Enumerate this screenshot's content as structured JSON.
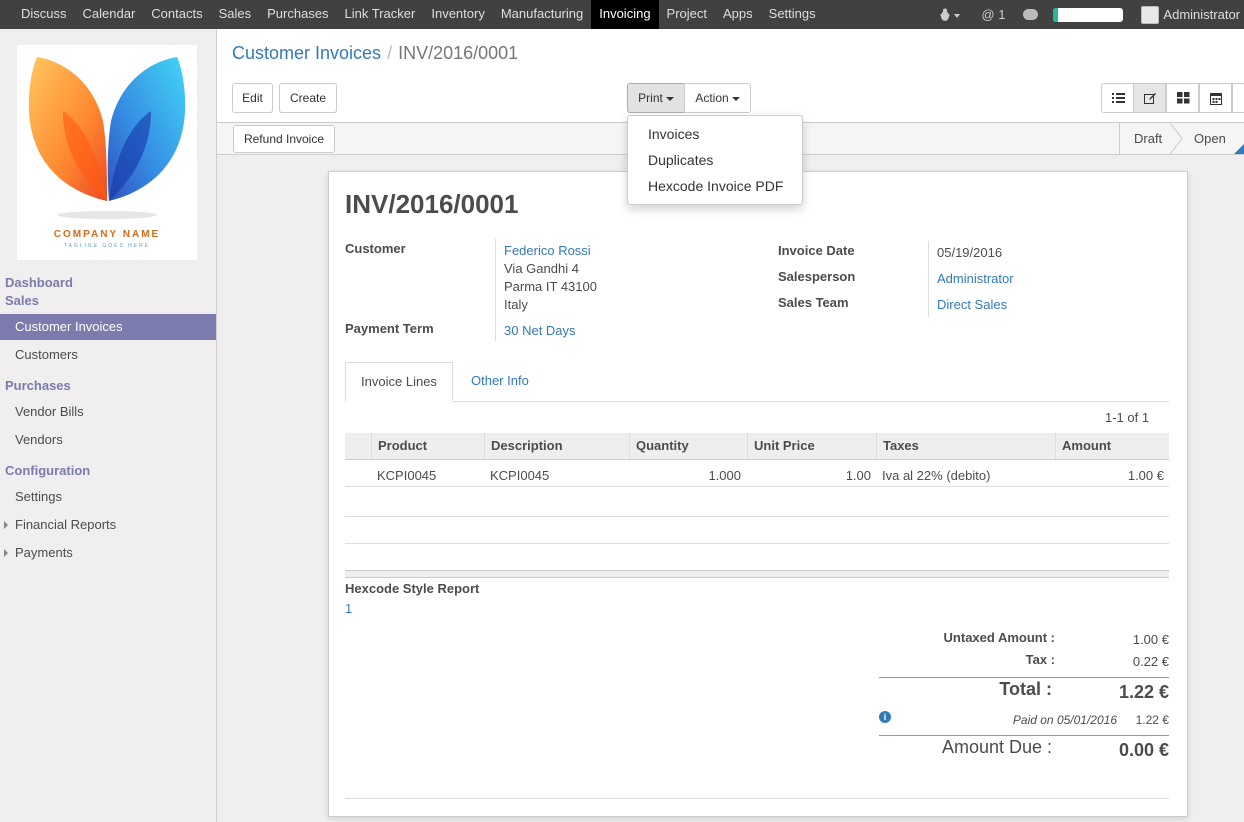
{
  "topbar": {
    "menu": [
      "Discuss",
      "Calendar",
      "Contacts",
      "Sales",
      "Purchases",
      "Link Tracker",
      "Inventory",
      "Manufacturing",
      "Invoicing",
      "Project",
      "Apps",
      "Settings"
    ],
    "active": "Invoicing",
    "at_count": "1",
    "user": "Administrator",
    "progress_fraction": 0.06
  },
  "sidebar": {
    "logo_name": "COMPANY NAME",
    "logo_tagline": "TAGLINE GOES HERE",
    "dashboard": "Dashboard",
    "sales": "Sales",
    "customer_invoices": "Customer Invoices",
    "customers": "Customers",
    "purchases": "Purchases",
    "vendor_bills": "Vendor Bills",
    "vendors": "Vendors",
    "configuration": "Configuration",
    "settings": "Settings",
    "financial_reports": "Financial Reports",
    "payments": "Payments"
  },
  "breadcrumb": {
    "parent": "Customer Invoices",
    "sep": "/",
    "current": "INV/2016/0001"
  },
  "buttons": {
    "edit": "Edit",
    "create": "Create",
    "print": "Print",
    "action": "Action",
    "refund": "Refund Invoice"
  },
  "print_menu": [
    "Invoices",
    "Duplicates",
    "Hexcode Invoice PDF"
  ],
  "stages": {
    "draft": "Draft",
    "open": "Open"
  },
  "invoice": {
    "number": "INV/2016/0001",
    "customer_label": "Customer",
    "customer_name": "Federico Rossi",
    "address1": "Via Gandhi 4",
    "address2": "Parma IT 43100",
    "address3": "Italy",
    "payment_term_label": "Payment Term",
    "payment_term": "30 Net Days",
    "invoice_date_label": "Invoice Date",
    "invoice_date": "05/19/2016",
    "salesperson_label": "Salesperson",
    "salesperson": "Administrator",
    "sales_team_label": "Sales Team",
    "sales_team": "Direct Sales"
  },
  "tabs": {
    "lines": "Invoice Lines",
    "other": "Other Info"
  },
  "pager": "1-1 of 1",
  "table": {
    "headers": [
      "Product",
      "Description",
      "Quantity",
      "Unit Price",
      "Taxes",
      "Amount"
    ],
    "row": {
      "product": "KCPI0045",
      "description": "KCPI0045",
      "quantity": "1.000",
      "unit_price": "1.00",
      "taxes": "Iva al 22% (debito)",
      "amount": "1.00 €"
    }
  },
  "report": {
    "label": "Hexcode Style Report",
    "value": "1"
  },
  "totals": {
    "untaxed_label": "Untaxed Amount :",
    "untaxed": "1.00 €",
    "tax_label": "Tax :",
    "tax": "0.22 €",
    "total_label": "Total :",
    "total": "1.22 €",
    "paid_label": "Paid on 05/01/2016",
    "paid": "1.22 €",
    "due_label": "Amount Due :",
    "due": "0.00 €"
  }
}
